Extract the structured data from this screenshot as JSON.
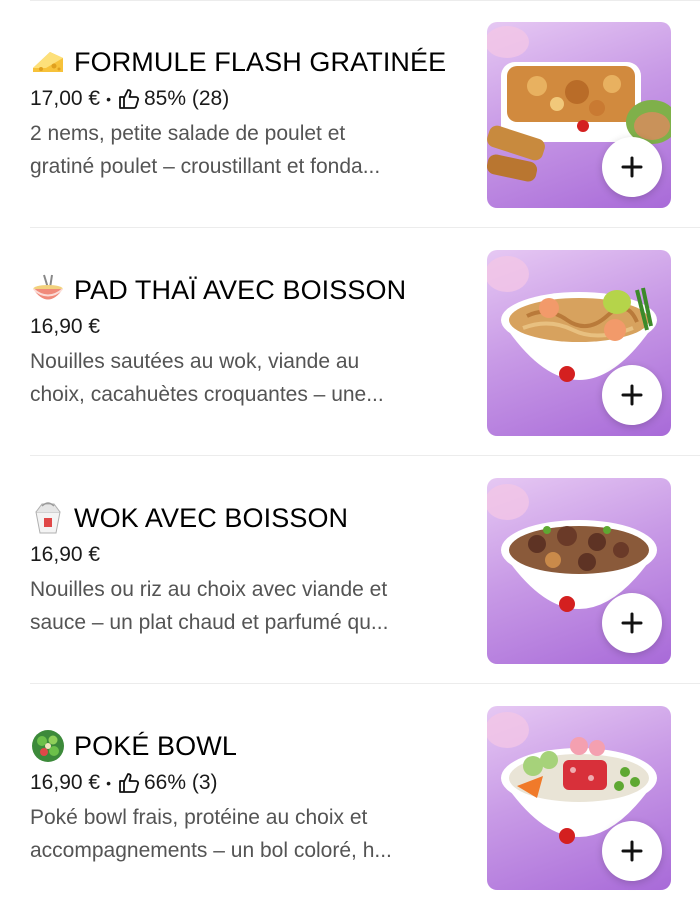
{
  "items": [
    {
      "title": "FORMULE FLASH GRATINÉE",
      "emoji": "cheese-icon",
      "price": "17,00 €",
      "rating": "85% (28)",
      "desc_line1": "2 nems, petite salade de poulet et",
      "desc_line2": "gratiné poulet – croustillant et fonda..."
    },
    {
      "title": "PAD THAÏ AVEC BOISSON",
      "emoji": "noodle-bowl-icon",
      "price": "16,90 €",
      "desc_line1": "Nouilles sautées au wok, viande au",
      "desc_line2": "choix, cacahuètes croquantes – une..."
    },
    {
      "title": "WOK AVEC BOISSON",
      "emoji": "takeout-box-icon",
      "price": "16,90 €",
      "desc_line1": "Nouilles ou riz au choix avec viande et",
      "desc_line2": "sauce – un plat chaud et parfumé qu..."
    },
    {
      "title": "POKÉ BOWL",
      "emoji": "salad-bowl-icon",
      "price": "16,90 €",
      "rating": "66% (3)",
      "desc_line1": "Poké bowl frais, protéine au choix et",
      "desc_line2": "accompagnements – un bol coloré, h..."
    }
  ],
  "colors": {
    "photo_bg": "#b887e3",
    "text_secondary": "#545454",
    "divider": "#ececec"
  }
}
